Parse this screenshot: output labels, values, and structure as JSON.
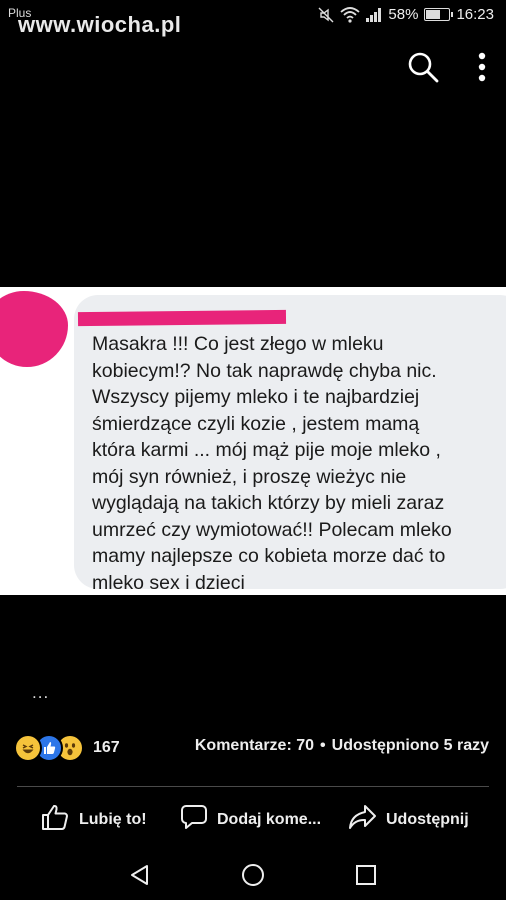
{
  "status_bar": {
    "carrier": "Plus",
    "battery_percent": "58%",
    "battery_level": 0.58,
    "time": "16:23",
    "icons": [
      "mute-icon",
      "wifi-icon",
      "signal-icon",
      "battery-icon"
    ]
  },
  "watermark": "www.wiocha.pl",
  "top_bar": {
    "icons": [
      "search-icon",
      "more-vertical-icon"
    ]
  },
  "post_image": {
    "comment_text": "Masakra !!! Co jest złego w mleku\nkobiecym!? No tak naprawdę chyba nic.\nWszyscy pijemy mleko i te najbardziej\nśmierdzące czyli kozie , jestem mamą\nktóra karmi ... mój mąż pije moje mleko ,\nmój syn również, i proszę wieżyc nie\nwyglądają na takich którzy by mieli zaraz\numrzeć czy wymiotować!! Polecam mleko\nmamy najlepsze co kobieta morze dać to\nmleko sex i dzieci",
    "colors": {
      "redaction": "#e8247a",
      "bubble": "#eceef1"
    }
  },
  "post": {
    "ellipsis": "...",
    "reaction_count": "167",
    "reactions": [
      "haha-reaction-icon",
      "like-reaction-icon",
      "wow-reaction-icon"
    ],
    "comments_label": "Komentarze: 70",
    "separator": "•",
    "shares_label": "Udostępniono 5 razy"
  },
  "actions": {
    "like": "Lubię to!",
    "comment": "Dodaj kome...",
    "share": "Udostępnij"
  },
  "nav": {
    "icons": [
      "back-icon",
      "home-icon",
      "recents-icon"
    ]
  }
}
